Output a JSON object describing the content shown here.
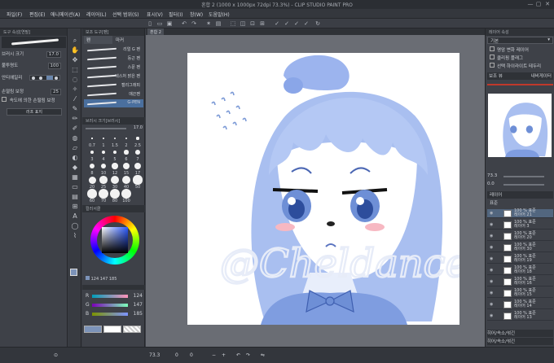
{
  "window": {
    "title": "혼합 2 (1000 x 1000px 72dpi 73.3%) - CLIP STUDIO PAINT PRO",
    "minimize": "—",
    "maximize": "▢",
    "close": "✕"
  },
  "menu": [
    "파일(F)",
    "편집(E)",
    "애니메이션(A)",
    "레이어(L)",
    "선택 범위(S)",
    "표시(V)",
    "필터(I)",
    "창(W)",
    "도움말(H)"
  ],
  "tool_property": {
    "header": "도구 속성[연필]",
    "brush_name": "연필",
    "size_label": "브러시 크기",
    "size_value": "17.0",
    "opacity_label": "불투명도",
    "opacity_value": "100",
    "antialias_label": "안티에일리",
    "stabilize_label": "손떨림 보정",
    "stabilize_value": "25",
    "speed_label": "속도에 의한 손떨림 보정",
    "sub_tool_label": "러프 표지"
  },
  "sub_tool": {
    "header": "보조 도구[펜]",
    "tabs": [
      "펜",
      "마커"
    ],
    "brushes": [
      "리얼 G 펜",
      "둥근 펜",
      "스푼 펜",
      "텍스처 밝은 펜",
      "캘리그래피",
      "매끈펜",
      "G-PEN"
    ],
    "selected_index": 6
  },
  "brush_size": {
    "header": "브러시 크기[브러시]",
    "current": "17.0",
    "sizes": [
      "0.7",
      "1",
      "1.5",
      "2",
      "2.5",
      "3",
      "4",
      "5",
      "6",
      "7",
      "8",
      "10",
      "12",
      "15",
      "17",
      "20",
      "25",
      "30",
      "40",
      "50",
      "60",
      "70",
      "80",
      "100"
    ]
  },
  "color": {
    "header": "컬러서클",
    "h": "124",
    "s": "147",
    "v": "185",
    "r_label": "R",
    "r_value": "124",
    "g_label": "G",
    "g_value": "147",
    "b_label": "B",
    "b_value": "185",
    "main_color": "#7c93b9",
    "sub_color": "#ffffff"
  },
  "canvas": {
    "tab_label": "혼합 2",
    "zoom": "73.3",
    "signature": "@Cheldance"
  },
  "navigator": {
    "header": "레이어 속성",
    "tabs": [
      "보조 뷰",
      "내비게이터"
    ],
    "zoom_value": "73.3",
    "angle_value": "0.0"
  },
  "layer_props": {
    "header": "레이어 속성",
    "blend_mode": "기본",
    "rows": [
      "명암 변화 레이어",
      "클리핑 플래그",
      "선택 하이라이트 테두리"
    ]
  },
  "layers": {
    "header": "레이어",
    "blend": "표준",
    "items": [
      {
        "opacity": "100 % 표준",
        "name": "레이어 21"
      },
      {
        "opacity": "100 % 표준",
        "name": "레이어 3"
      },
      {
        "opacity": "100 % 표준",
        "name": "레이어 20"
      },
      {
        "opacity": "100 % 표준",
        "name": "레이어 30"
      },
      {
        "opacity": "100 % 표준",
        "name": "레이어 19"
      },
      {
        "opacity": "100 % 표준",
        "name": "레이어 18"
      },
      {
        "opacity": "100 % 표준",
        "name": "레이어 16"
      },
      {
        "opacity": "100 % 표준",
        "name": "레이어 15"
      },
      {
        "opacity": "100 % 표준",
        "name": "레이어 14"
      },
      {
        "opacity": "100 % 표준",
        "name": "레이어 13"
      }
    ],
    "selected_index": 0,
    "footer_1": "히어/속소/섞긴",
    "footer_2": "히어/속소/섞긴"
  },
  "status": {
    "zoom": "73.3",
    "x": "0",
    "y": "0"
  }
}
